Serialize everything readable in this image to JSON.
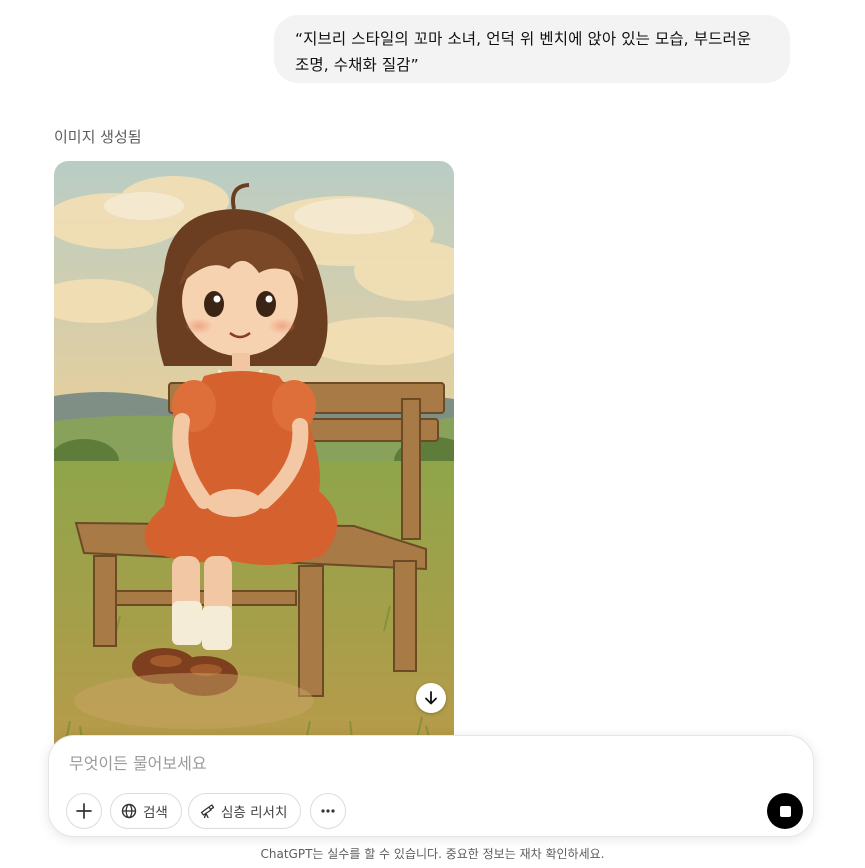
{
  "conversation": {
    "user_message": "“지브리 스타일의 꼬마 소녀, 언덕 위 벤치에 앉아 있는 모습, 부드러운 조명, 수채화 질감”",
    "generated_label": "이미지 생성됨",
    "image": {
      "description_icon": "illustration",
      "download_icon": "arrow-down-icon"
    }
  },
  "composer": {
    "placeholder": "무엇이든 물어보세요",
    "buttons": {
      "plus_icon": "plus-icon",
      "search_label": "검색",
      "search_icon": "globe-icon",
      "research_label": "심층 리서치",
      "research_icon": "telescope-icon",
      "more_icon": "ellipsis-icon",
      "stop_icon": "stop-icon"
    }
  },
  "footer": {
    "disclaimer": "ChatGPT는 실수를 할 수 있습니다. 중요한 정보는 재차 확인하세요."
  },
  "colors": {
    "bubble_bg": "#f3f3f3",
    "stop_button": "#000000",
    "dress": "#d5612e",
    "bench": "#a87a46",
    "grass": "#9fae4a",
    "sky": "#bfd0c6"
  }
}
